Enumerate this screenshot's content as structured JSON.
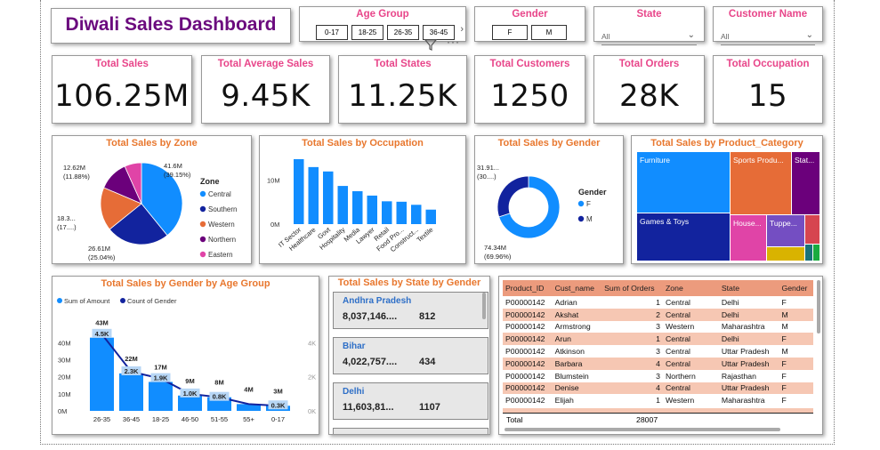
{
  "dashboard_title": "Diwali Sales Dashboard",
  "slicers": {
    "age_group": {
      "title": "Age Group",
      "options": [
        "0-17",
        "18-25",
        "26-35",
        "36-45"
      ]
    },
    "gender": {
      "title": "Gender",
      "options": [
        "F",
        "M"
      ]
    },
    "state": {
      "title": "State",
      "value": "All"
    },
    "customer_name": {
      "title": "Customer Name",
      "value": "All"
    }
  },
  "kpis": [
    {
      "title": "Total Sales",
      "value": "106.25M"
    },
    {
      "title": "Total Average Sales",
      "value": "9.45K"
    },
    {
      "title": "Total States",
      "value": "11.25K"
    },
    {
      "title": "Total Customers",
      "value": "1250"
    },
    {
      "title": "Total Orders",
      "value": "28K"
    },
    {
      "title": "Total Occupation",
      "value": "15"
    }
  ],
  "colors": {
    "blue": "#118dff",
    "navy": "#12239e",
    "orange": "#e66c37",
    "purple": "#6b007b",
    "pink": "#e044a7",
    "yellow": "#d9b300",
    "red": "#d64550",
    "green": "#197278",
    "title_orange": "#e8772e",
    "title_pink": "#e8468a"
  },
  "chart_data": [
    {
      "type": "pie",
      "title": "Total Sales by Zone",
      "legend_title": "Zone",
      "categories": [
        "Central",
        "Southern",
        "Western",
        "Northern",
        "Eastern"
      ],
      "values": [
        41.6,
        26.61,
        18.3,
        12.62,
        7.12
      ],
      "unit": "M",
      "labels": [
        "41.6M\n(39.15%)",
        "26.61M\n(25.04%)",
        "18.3...\n(17....)",
        "12.62M\n(11.88%)",
        ""
      ]
    },
    {
      "type": "bar",
      "title": "Total Sales by Occupation",
      "categories": [
        "IT Sector",
        "Healthcare",
        "Govt",
        "Hospitality",
        "Media",
        "Lawyer",
        "Retail",
        "Food Pro...",
        "Construct...",
        "Textile"
      ],
      "values": [
        14.8,
        13.0,
        12.0,
        8.7,
        7.5,
        6.5,
        5.2,
        5.1,
        4.4,
        3.3
      ],
      "unit": "M",
      "yticks": [
        "0M",
        "10M"
      ]
    },
    {
      "type": "pie",
      "title": "Total Sales by Gender",
      "legend_title": "Gender",
      "categories": [
        "F",
        "M"
      ],
      "values": [
        74.34,
        31.91
      ],
      "unit": "M",
      "labels": [
        "74.34M\n(69.96%)",
        "31.91...\n(30....)"
      ]
    },
    {
      "type": "heatmap",
      "title": "Total Sales by Product_Category",
      "categories": [
        "Furniture",
        "Sports Produ...",
        "Stat...",
        "Games & Toys",
        "House...",
        "Tuppe..."
      ]
    },
    {
      "type": "bar",
      "title": "Total Sales by Gender by Age Group",
      "categories": [
        "26-35",
        "36-45",
        "18-25",
        "46-50",
        "51-55",
        "55+",
        "0-17"
      ],
      "series": [
        {
          "name": "Sum of Amount",
          "values": [
            43,
            22,
            17,
            9,
            8,
            4,
            3
          ],
          "labels": [
            "43M",
            "22M",
            "17M",
            "9M",
            "8M",
            "4M",
            "3M"
          ]
        },
        {
          "name": "Count of Gender",
          "values": [
            4.5,
            2.3,
            1.9,
            1.0,
            0.8,
            0.4,
            0.3
          ],
          "labels": [
            "4.5K",
            "2.3K",
            "1.9K",
            "1.0K",
            "0.8K",
            "",
            "0.3K"
          ]
        }
      ],
      "yticks_left": [
        "0M",
        "10M",
        "20M",
        "30M",
        "40M"
      ],
      "yticks_right": [
        "0K",
        "2K",
        "4K"
      ]
    }
  ],
  "states_card": {
    "title": "Total Sales by State by Gender",
    "items": [
      {
        "name": "Andhra Pradesh",
        "sales": "8,037,146....",
        "count": "812"
      },
      {
        "name": "Bihar",
        "sales": "4,022,757....",
        "count": "434"
      },
      {
        "name": "Delhi",
        "sales": "11,603,81...",
        "count": "1107"
      }
    ]
  },
  "table": {
    "columns": [
      "Product_ID",
      "Cust_name",
      "Sum of Orders",
      "Zone",
      "State",
      "Gender"
    ],
    "rows": [
      [
        "P00000142",
        "Adrian",
        "1",
        "Central",
        "Delhi",
        "F"
      ],
      [
        "P00000142",
        "Akshat",
        "2",
        "Central",
        "Delhi",
        "M"
      ],
      [
        "P00000142",
        "Armstrong",
        "3",
        "Western",
        "Maharashtra",
        "M"
      ],
      [
        "P00000142",
        "Arun",
        "1",
        "Central",
        "Delhi",
        "F"
      ],
      [
        "P00000142",
        "Atkinson",
        "3",
        "Central",
        "Uttar Pradesh",
        "M"
      ],
      [
        "P00000142",
        "Barbara",
        "4",
        "Central",
        "Uttar Pradesh",
        "F"
      ],
      [
        "P00000142",
        "Blumstein",
        "3",
        "Northern",
        "Rajasthan",
        "F"
      ],
      [
        "P00000142",
        "Denise",
        "4",
        "Central",
        "Uttar Pradesh",
        "F"
      ],
      [
        "P00000142",
        "Elijah",
        "1",
        "Western",
        "Maharashtra",
        "F"
      ]
    ],
    "total_label": "Total",
    "total_value": "28007"
  }
}
